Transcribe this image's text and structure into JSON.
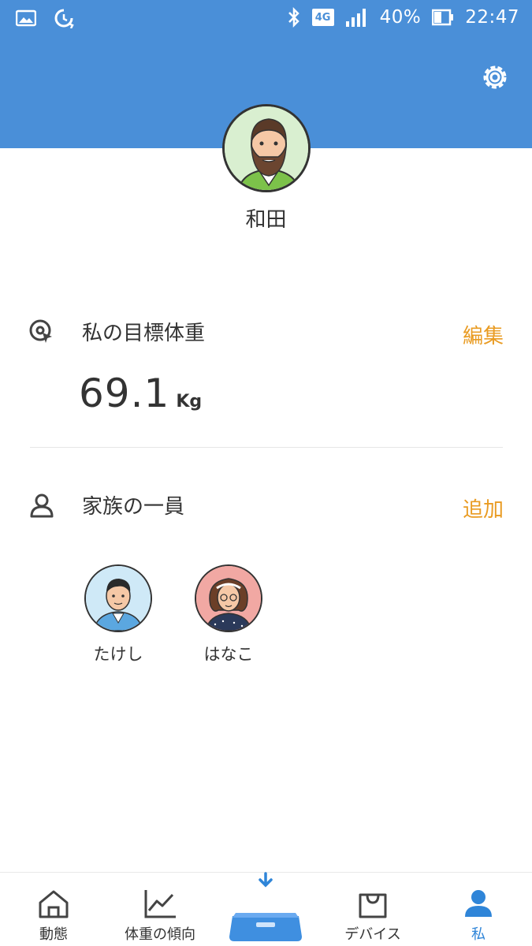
{
  "statusbar": {
    "battery": "40%",
    "time": "22:47",
    "network": "4G"
  },
  "profile": {
    "name": "和田"
  },
  "goal": {
    "title": "私の目標体重",
    "action": "編集",
    "value": "69.1",
    "unit": "Kg"
  },
  "family": {
    "title": "家族の一員",
    "action": "追加",
    "members": [
      {
        "name": "たけし"
      },
      {
        "name": "はなこ"
      }
    ]
  },
  "nav": {
    "items": [
      {
        "label": "動態",
        "icon": "home-icon"
      },
      {
        "label": "体重の傾向",
        "icon": "trend-chart-icon"
      },
      {
        "label": "",
        "icon": "scale-icon"
      },
      {
        "label": "デバイス",
        "icon": "shopping-bag-icon"
      },
      {
        "label": "私",
        "icon": "person-icon"
      }
    ],
    "active_color": "#2f85d8"
  },
  "colors": {
    "header": "#4a8fd8",
    "accent": "#e99b22"
  }
}
